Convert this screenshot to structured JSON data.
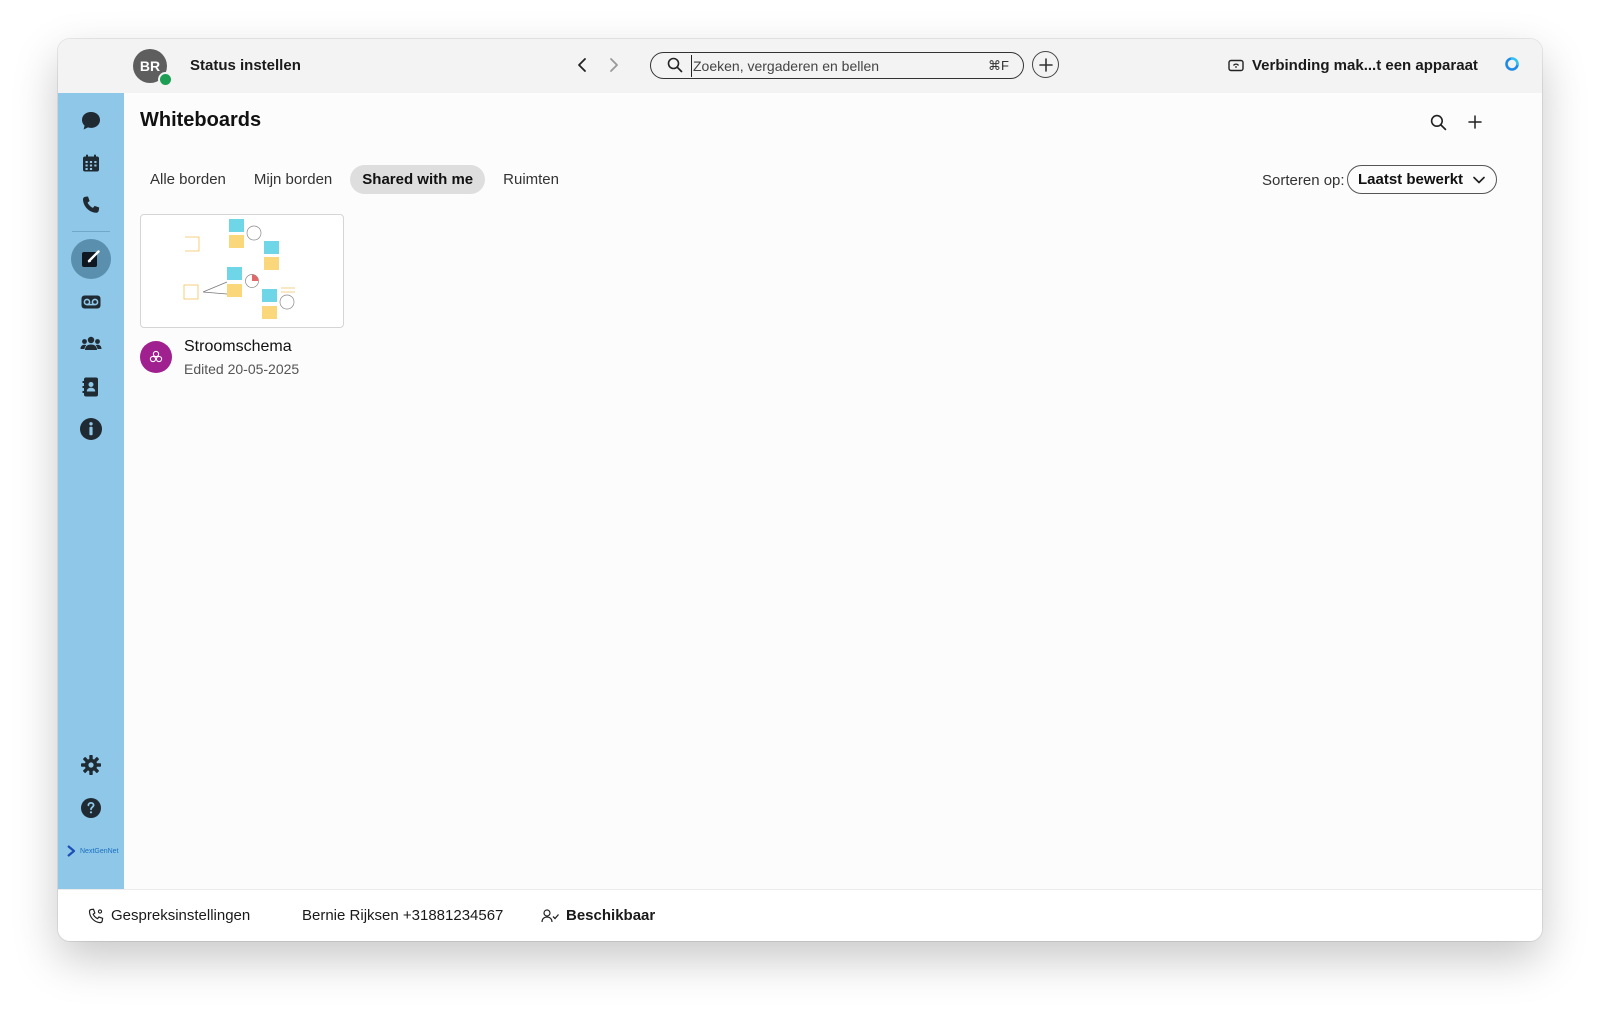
{
  "topbar": {
    "avatar_initials": "BR",
    "status_text": "Status instellen",
    "search_placeholder": "Zoeken, vergaderen en bellen",
    "search_shortcut": "⌘F",
    "connect_text": "Verbinding mak...t een apparaat"
  },
  "sidebar": {
    "items": [
      {
        "icon": "chat-icon"
      },
      {
        "icon": "calendar-icon"
      },
      {
        "icon": "phone-icon"
      },
      {
        "icon": "whiteboard-icon",
        "active": true
      },
      {
        "icon": "voicemail-icon"
      },
      {
        "icon": "teams-icon"
      },
      {
        "icon": "contacts-icon"
      },
      {
        "icon": "info-icon"
      },
      {
        "icon": "gear-icon"
      },
      {
        "icon": "help-icon"
      }
    ],
    "brand_text": "NextGenNet"
  },
  "main": {
    "title": "Whiteboards",
    "tabs": [
      {
        "label": "Alle borden"
      },
      {
        "label": "Mijn borden"
      },
      {
        "label": "Shared with me",
        "active": true
      },
      {
        "label": "Ruimten"
      }
    ],
    "sort_label": "Sorteren op:",
    "sort_value": "Laatst bewerkt",
    "cards": [
      {
        "title": "Stroomschema",
        "subtitle": "Edited 20-05-2025"
      }
    ]
  },
  "footer": {
    "call_settings": "Gespreksinstellingen",
    "user_line": "Bernie Rijksen +31881234567",
    "availability": "Beschikbaar"
  },
  "colors": {
    "sidebar_bg": "#8ec7e8",
    "presence_green": "#1e9e54",
    "card_avatar": "#a0208f",
    "sticky_blue": "#6fd6e8",
    "sticky_yellow": "#f9d77a"
  }
}
